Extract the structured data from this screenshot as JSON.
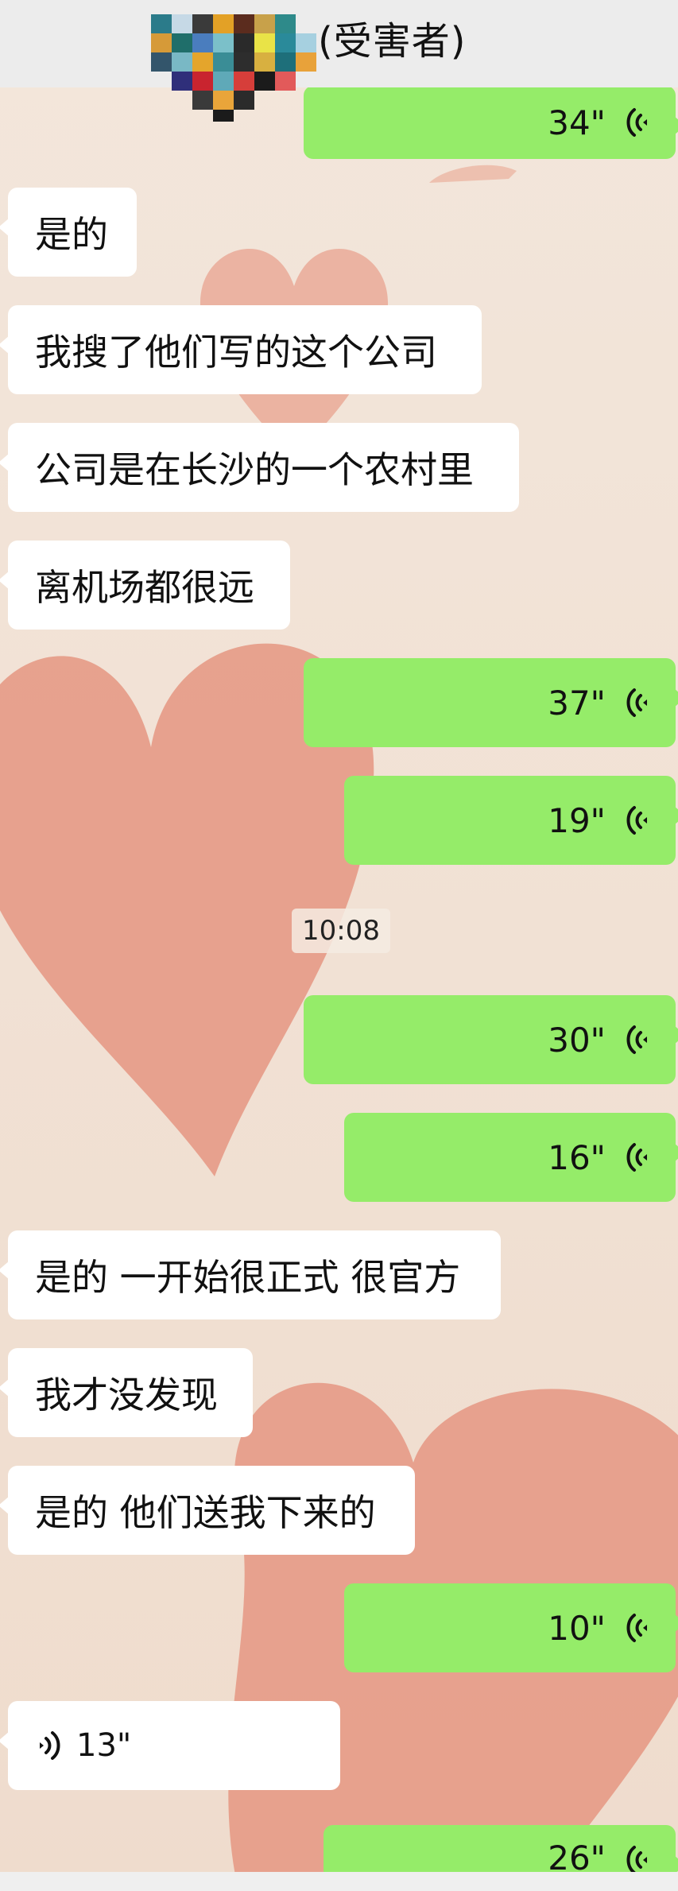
{
  "header": {
    "title": "(受害者)"
  },
  "timestamp": "10:08",
  "messages": [
    {
      "side": "right",
      "kind": "voice",
      "duration": "34\""
    },
    {
      "side": "left",
      "kind": "text",
      "text": "是的"
    },
    {
      "side": "left",
      "kind": "text",
      "text": "我搜了他们写的这个公司"
    },
    {
      "side": "left",
      "kind": "text",
      "text": "公司是在长沙的一个农村里"
    },
    {
      "side": "left",
      "kind": "text",
      "text": "离机场都很远"
    },
    {
      "side": "right",
      "kind": "voice",
      "duration": "37\""
    },
    {
      "side": "right",
      "kind": "voice",
      "duration": "19\""
    },
    {
      "side": "right",
      "kind": "voice",
      "duration": "30\""
    },
    {
      "side": "right",
      "kind": "voice",
      "duration": "16\""
    },
    {
      "side": "left",
      "kind": "text",
      "text": "是的 一开始很正式 很官方"
    },
    {
      "side": "left",
      "kind": "text",
      "text": "我才没发现"
    },
    {
      "side": "left",
      "kind": "text",
      "text": "是的 他们送我下来的"
    },
    {
      "side": "right",
      "kind": "voice",
      "duration": "10\""
    },
    {
      "side": "left",
      "kind": "voice",
      "duration": "13\""
    },
    {
      "side": "right",
      "kind": "voice",
      "duration": "26\""
    }
  ],
  "colors": {
    "sent_bubble": "#95ec69",
    "received_bubble": "#ffffff",
    "header_bg": "#ececec",
    "chat_bg": "#f1e2d6"
  },
  "icons": {
    "voice": "voice-wave-icon",
    "avatar": "pixelated-avatar"
  }
}
